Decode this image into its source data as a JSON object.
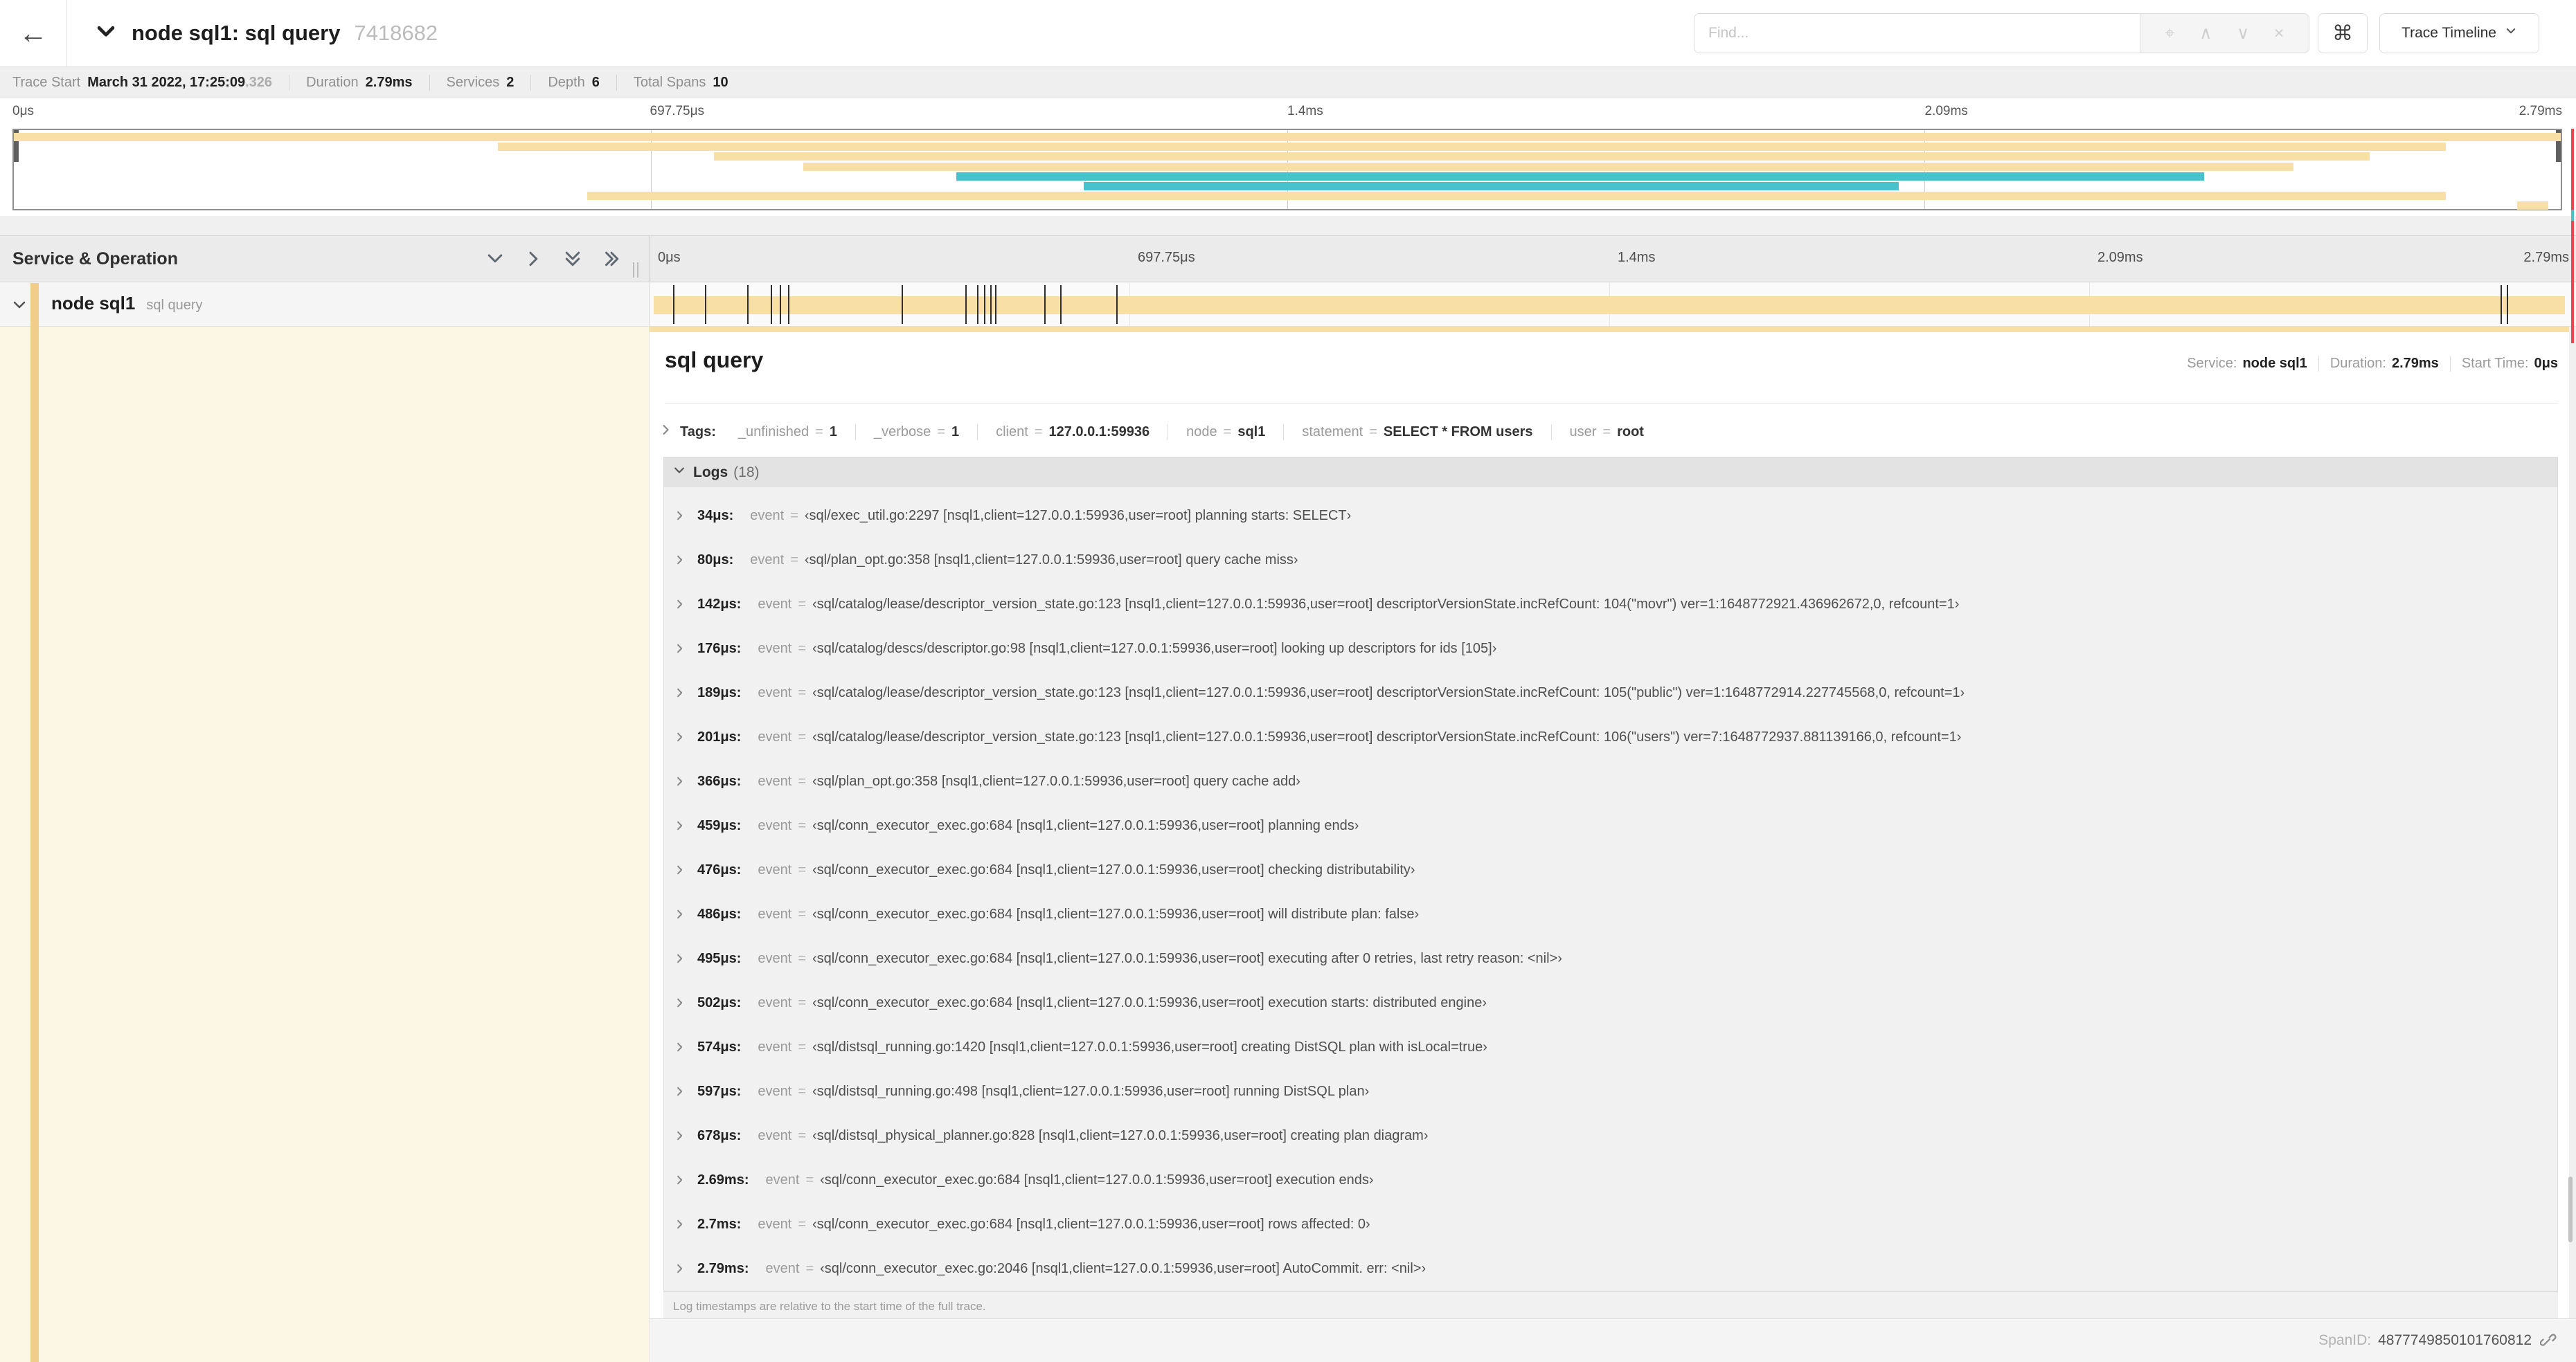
{
  "header": {
    "back_icon": "←",
    "title": "node sql1: sql query",
    "trace_id_short": "7418682",
    "find": {
      "placeholder": "Find...",
      "locate_icon": "⌖",
      "prev_icon": "∧",
      "next_icon": "∨",
      "clear_icon": "×"
    },
    "shortcut_icon": "⌘",
    "view_select": {
      "label": "Trace Timeline"
    }
  },
  "trace_info": {
    "items": [
      {
        "label": "Trace Start",
        "value": "March 31 2022, 17:25:09",
        "suffix": ".326"
      },
      {
        "label": "Duration",
        "value": "2.79ms",
        "suffix": ""
      },
      {
        "label": "Services",
        "value": "2",
        "suffix": ""
      },
      {
        "label": "Depth",
        "value": "6",
        "suffix": ""
      },
      {
        "label": "Total Spans",
        "value": "10",
        "suffix": ""
      }
    ]
  },
  "minimap": {
    "colors": {
      "tan": "#f7dfa6",
      "teal": "#48c3cb"
    },
    "spans": [
      {
        "row": 0,
        "start_pct": 0,
        "end_pct": 100,
        "color": "tan"
      },
      {
        "row": 1,
        "start_pct": 19,
        "end_pct": 95.5,
        "color": "tan"
      },
      {
        "row": 2,
        "start_pct": 27.5,
        "end_pct": 92.5,
        "color": "tan"
      },
      {
        "row": 3,
        "start_pct": 31,
        "end_pct": 89.5,
        "color": "tan"
      },
      {
        "row": 4,
        "start_pct": 37,
        "end_pct": 86,
        "color": "teal"
      },
      {
        "row": 5,
        "start_pct": 42,
        "end_pct": 74,
        "color": "teal"
      },
      {
        "row": 6,
        "start_pct": 22.5,
        "end_pct": 95.5,
        "color": "tan"
      },
      {
        "row": 7,
        "start_pct": 98.3,
        "end_pct": 99.5,
        "color": "tan"
      }
    ]
  },
  "timeline": {
    "left_header": "Service & Operation",
    "ticks": [
      "0μs",
      "697.75μs",
      "1.4ms",
      "2.09ms",
      "2.79ms"
    ],
    "tick_positions_pct": [
      0,
      25,
      50,
      75,
      100
    ],
    "row": {
      "service": "node sql1",
      "operation": "sql query",
      "bar_start_pct": 0.2,
      "bar_end_pct": 99.8,
      "log_marker_pcts": [
        1.22,
        2.87,
        5.09,
        6.31,
        6.77,
        7.2,
        13.12,
        16.45,
        17.06,
        17.42,
        17.74,
        17.99,
        20.57,
        21.4,
        24.3,
        96.42,
        96.77
      ]
    }
  },
  "detail": {
    "title": "sql query",
    "meta": [
      {
        "label": "Service:",
        "value": "node sql1"
      },
      {
        "label": "Duration:",
        "value": "2.79ms"
      },
      {
        "label": "Start Time:",
        "value": "0μs"
      }
    ],
    "tags_label": "Tags:",
    "tags": [
      {
        "key": "_unfinished",
        "value": "1"
      },
      {
        "key": "_verbose",
        "value": "1"
      },
      {
        "key": "client",
        "value": "127.0.0.1:59936"
      },
      {
        "key": "node",
        "value": "sql1"
      },
      {
        "key": "statement",
        "value": "SELECT * FROM users"
      },
      {
        "key": "user",
        "value": "root"
      }
    ],
    "logs_label": "Logs",
    "logs_count": "(18)",
    "logs_field": "event",
    "logs": [
      {
        "time": "34μs:",
        "value": "‹sql/exec_util.go:2297 [nsql1,client=127.0.0.1:59936,user=root] planning starts: SELECT›"
      },
      {
        "time": "80μs:",
        "value": "‹sql/plan_opt.go:358 [nsql1,client=127.0.0.1:59936,user=root] query cache miss›"
      },
      {
        "time": "142μs:",
        "value": "‹sql/catalog/lease/descriptor_version_state.go:123 [nsql1,client=127.0.0.1:59936,user=root] descriptorVersionState.incRefCount: 104(\"movr\") ver=1:1648772921.436962672,0, refcount=1›"
      },
      {
        "time": "176μs:",
        "value": "‹sql/catalog/descs/descriptor.go:98 [nsql1,client=127.0.0.1:59936,user=root] looking up descriptors for ids [105]›"
      },
      {
        "time": "189μs:",
        "value": "‹sql/catalog/lease/descriptor_version_state.go:123 [nsql1,client=127.0.0.1:59936,user=root] descriptorVersionState.incRefCount: 105(\"public\") ver=1:1648772914.227745568,0, refcount=1›"
      },
      {
        "time": "201μs:",
        "value": "‹sql/catalog/lease/descriptor_version_state.go:123 [nsql1,client=127.0.0.1:59936,user=root] descriptorVersionState.incRefCount: 106(\"users\") ver=7:1648772937.881139166,0, refcount=1›"
      },
      {
        "time": "366μs:",
        "value": "‹sql/plan_opt.go:358 [nsql1,client=127.0.0.1:59936,user=root] query cache add›"
      },
      {
        "time": "459μs:",
        "value": "‹sql/conn_executor_exec.go:684 [nsql1,client=127.0.0.1:59936,user=root] planning ends›"
      },
      {
        "time": "476μs:",
        "value": "‹sql/conn_executor_exec.go:684 [nsql1,client=127.0.0.1:59936,user=root] checking distributability›"
      },
      {
        "time": "486μs:",
        "value": "‹sql/conn_executor_exec.go:684 [nsql1,client=127.0.0.1:59936,user=root] will distribute plan: false›"
      },
      {
        "time": "495μs:",
        "value": "‹sql/conn_executor_exec.go:684 [nsql1,client=127.0.0.1:59936,user=root] executing after 0 retries, last retry reason: <nil>›"
      },
      {
        "time": "502μs:",
        "value": "‹sql/conn_executor_exec.go:684 [nsql1,client=127.0.0.1:59936,user=root] execution starts: distributed engine›"
      },
      {
        "time": "574μs:",
        "value": "‹sql/distsql_running.go:1420 [nsql1,client=127.0.0.1:59936,user=root] creating DistSQL plan with isLocal=true›"
      },
      {
        "time": "597μs:",
        "value": "‹sql/distsql_running.go:498 [nsql1,client=127.0.0.1:59936,user=root] running DistSQL plan›"
      },
      {
        "time": "678μs:",
        "value": "‹sql/distsql_physical_planner.go:828 [nsql1,client=127.0.0.1:59936,user=root] creating plan diagram›"
      },
      {
        "time": "2.69ms:",
        "value": "‹sql/conn_executor_exec.go:684 [nsql1,client=127.0.0.1:59936,user=root] execution ends›"
      },
      {
        "time": "2.7ms:",
        "value": "‹sql/conn_executor_exec.go:684 [nsql1,client=127.0.0.1:59936,user=root] rows affected: 0›"
      },
      {
        "time": "2.79ms:",
        "value": "‹sql/conn_executor_exec.go:2046 [nsql1,client=127.0.0.1:59936,user=root] AutoCommit. err: <nil>›"
      }
    ],
    "footer_note": "Log timestamps are relative to the start time of the full trace.",
    "span_id_label": "SpanID:",
    "span_id": "4877749850101760812"
  }
}
